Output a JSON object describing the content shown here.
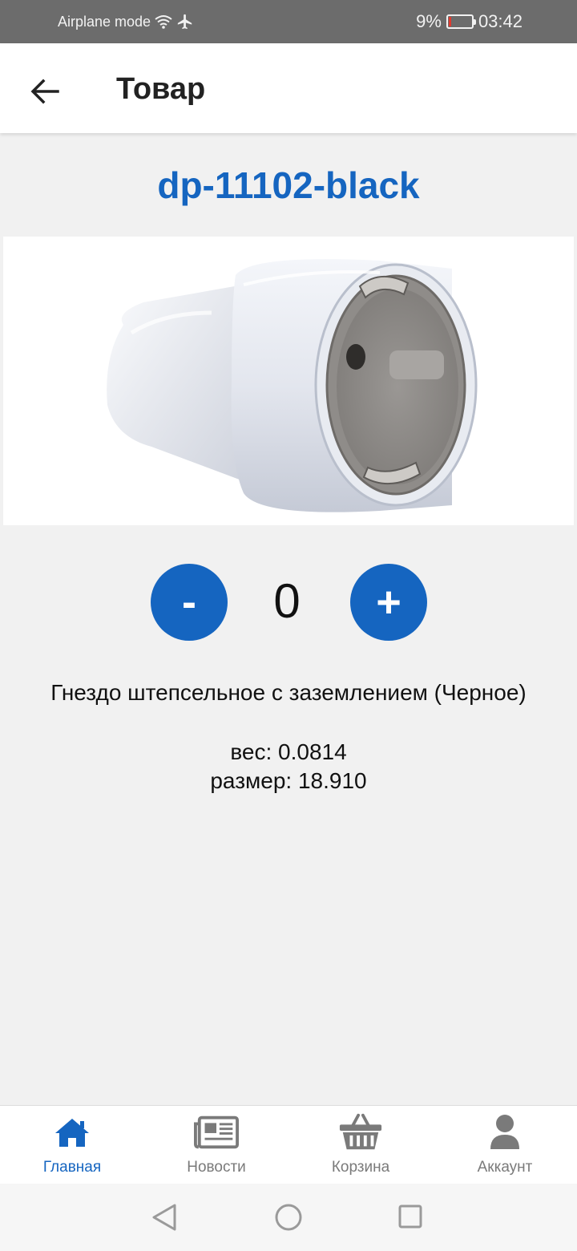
{
  "status_bar": {
    "left_text": "Airplane mode",
    "battery_percent": "9%",
    "time": "03:42",
    "battery_level": 0.09,
    "icons": [
      "wifi-icon",
      "airplane-icon",
      "battery-icon"
    ]
  },
  "app_bar": {
    "title": "Товар",
    "back_icon": "arrow-left-icon"
  },
  "product": {
    "code": "dp-11102-black",
    "image_alt": "socket-image",
    "quantity": "0",
    "minus_label": "-",
    "plus_label": "+",
    "description": "Гнездо штепсельное с заземлением (Черное)",
    "weight": "вес: 0.0814",
    "size": "размер: 18.910"
  },
  "bottom_nav": {
    "items": [
      {
        "label": "Главная",
        "icon": "home-icon",
        "active": true
      },
      {
        "label": "Новости",
        "icon": "newspaper-icon",
        "active": false
      },
      {
        "label": "Корзина",
        "icon": "basket-icon",
        "active": false
      },
      {
        "label": "Аккаунт",
        "icon": "user-icon",
        "active": false
      }
    ]
  },
  "system_nav": {
    "icons": [
      "back-triangle-icon",
      "home-circle-icon",
      "recents-square-icon"
    ]
  },
  "colors": {
    "accent": "#1565c0",
    "background": "#f1f1f1",
    "status_bar": "#6c6c6c",
    "inactive": "#7a7a7a"
  }
}
